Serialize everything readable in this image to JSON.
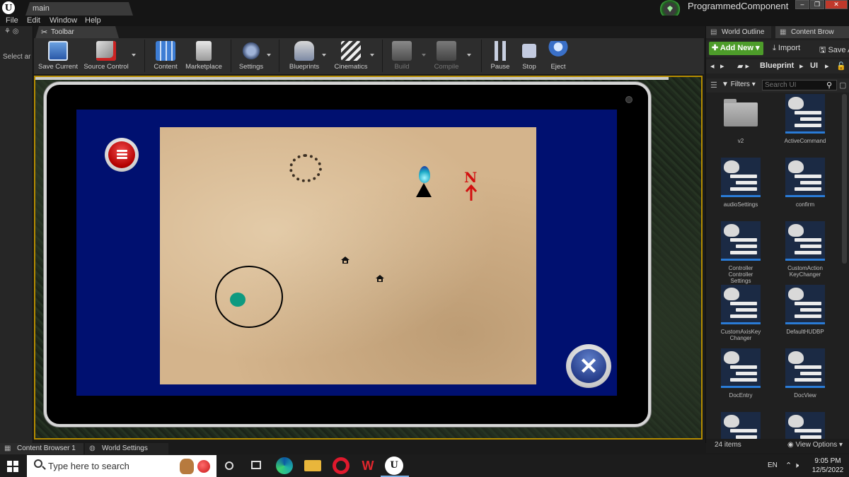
{
  "titlebar": {
    "tab": "main",
    "project": "ProgrammedComponent"
  },
  "menu": [
    "File",
    "Edit",
    "Window",
    "Help"
  ],
  "left_panel": {
    "select_text": "Select ar"
  },
  "toolbar": {
    "tab_label": "Toolbar",
    "buttons": [
      {
        "label": "Save Current",
        "icon": "save-icon"
      },
      {
        "label": "Source Control",
        "icon": "source-control-icon"
      },
      {
        "label": "Content",
        "icon": "content-icon"
      },
      {
        "label": "Marketplace",
        "icon": "marketplace-icon"
      },
      {
        "label": "Settings",
        "icon": "settings-icon"
      },
      {
        "label": "Blueprints",
        "icon": "blueprints-icon"
      },
      {
        "label": "Cinematics",
        "icon": "cinematics-icon"
      },
      {
        "label": "Build",
        "icon": "build-icon"
      },
      {
        "label": "Compile",
        "icon": "compile-icon"
      },
      {
        "label": "Pause",
        "icon": "pause-icon"
      },
      {
        "label": "Stop",
        "icon": "stop-icon"
      },
      {
        "label": "Eject",
        "icon": "eject-icon"
      }
    ]
  },
  "viewport": {
    "map": {
      "north_label": "N",
      "menu_icon": "menu-list-icon",
      "close_icon": "close-icon",
      "colors": {
        "screen": "#001070",
        "parchment": "#d4b48c",
        "joystick": "#0e9a80",
        "north": "#d21010"
      }
    }
  },
  "right_panel": {
    "tabs": [
      "World Outline",
      "Content Brow"
    ],
    "add_new": "Add New",
    "import": "Import",
    "save": "Save A",
    "path": [
      "Blueprint",
      "UI"
    ],
    "filters": "Filters",
    "search_placeholder": "Search UI",
    "assets": [
      {
        "name": "v2",
        "type": "folder"
      },
      {
        "name": "ActiveCommand",
        "type": "widget"
      },
      {
        "name": "audioSettings",
        "type": "widget"
      },
      {
        "name": "confirm",
        "type": "widget"
      },
      {
        "name": "Controller\nController\nSettings",
        "type": "widget"
      },
      {
        "name": "CustomAction\nKeyChanger",
        "type": "widget"
      },
      {
        "name": "CustomAxisKey\nChanger",
        "type": "widget"
      },
      {
        "name": "DefaultHUDBP",
        "type": "widget"
      },
      {
        "name": "DocEntry",
        "type": "widget"
      },
      {
        "name": "DocView",
        "type": "widget"
      },
      {
        "name": "",
        "type": "widget"
      },
      {
        "name": "",
        "type": "widget"
      }
    ],
    "item_count": "24 items",
    "view_options": "View Options"
  },
  "bottom_tabs": [
    "Content Browser 1",
    "World Settings"
  ],
  "taskbar": {
    "search_placeholder": "Type here to search",
    "lang": "EN",
    "time": "9:05 PM",
    "date": "12/5/2022"
  }
}
